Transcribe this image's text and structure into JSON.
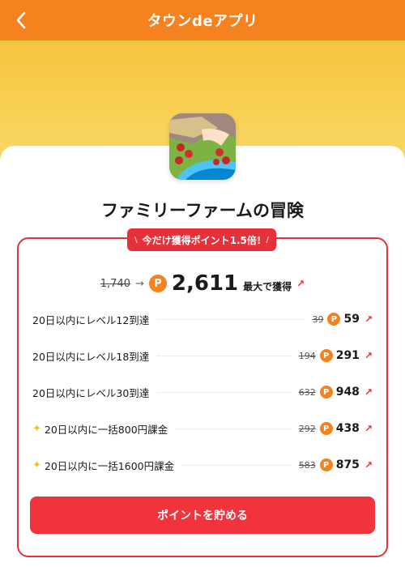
{
  "header": {
    "title": "タウンdeアプリ"
  },
  "app": {
    "name": "ファミリーファームの冒険"
  },
  "promo": {
    "text": "今だけ獲得ポイント1.5倍!"
  },
  "total": {
    "old": "1,740",
    "arrow": "→",
    "coin": "P",
    "new": "2,611",
    "suffix": "最大で獲得",
    "arrow_icon": "↗"
  },
  "missions": [
    {
      "label": "20日以内にレベル12到達",
      "old": "39",
      "points": "59",
      "star": false
    },
    {
      "label": "20日以内にレベル18到達",
      "old": "194",
      "points": "291",
      "star": false
    },
    {
      "label": "20日以内にレベル30到達",
      "old": "632",
      "points": "948",
      "star": false
    },
    {
      "label": "20日以内に一括800円課金",
      "old": "292",
      "points": "438",
      "star": true
    },
    {
      "label": "20日以内に一括1600円課金",
      "old": "583",
      "points": "875",
      "star": true
    }
  ],
  "cta": {
    "label": "ポイントを貯める"
  },
  "colors": {
    "accent": "#f5821f",
    "red": "#e8303a",
    "header": "#f5821f"
  }
}
